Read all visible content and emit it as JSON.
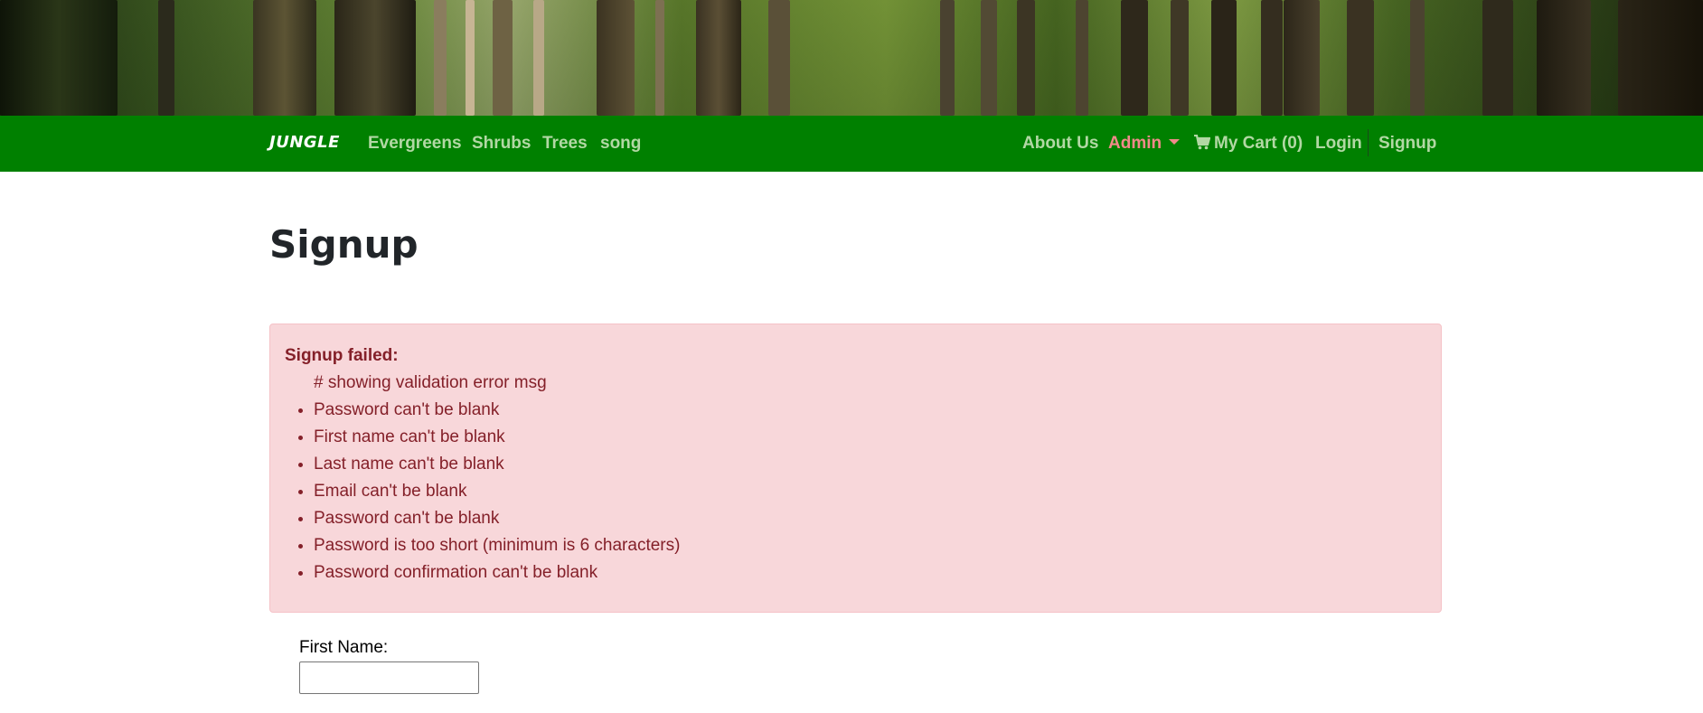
{
  "nav": {
    "brand": "JUNGLE",
    "left_links": [
      "Evergreens",
      "Shrubs",
      "Trees",
      "song"
    ],
    "about": "About Us",
    "admin": "Admin",
    "cart": "My Cart (0)",
    "login": "Login",
    "signup": "Signup",
    "background_color": "#008000",
    "link_color": "#b2d8a4",
    "admin_color": "#f28a8a"
  },
  "page": {
    "title": "Signup"
  },
  "alert": {
    "heading": "Signup failed:",
    "comment": "# showing validation error msg",
    "errors": [
      "Password can't be blank",
      "First name can't be blank",
      "Last name can't be blank",
      "Email can't be blank",
      "Password can't be blank",
      "Password is too short (minimum is 6 characters)",
      "Password confirmation can't be blank"
    ],
    "background_color": "#f8d7da",
    "text_color": "#842029"
  },
  "form": {
    "first_name_label": "First Name:",
    "first_name_value": ""
  },
  "icons": {
    "cart": "shopping-cart-icon",
    "admin_caret": "chevron-down-icon"
  }
}
